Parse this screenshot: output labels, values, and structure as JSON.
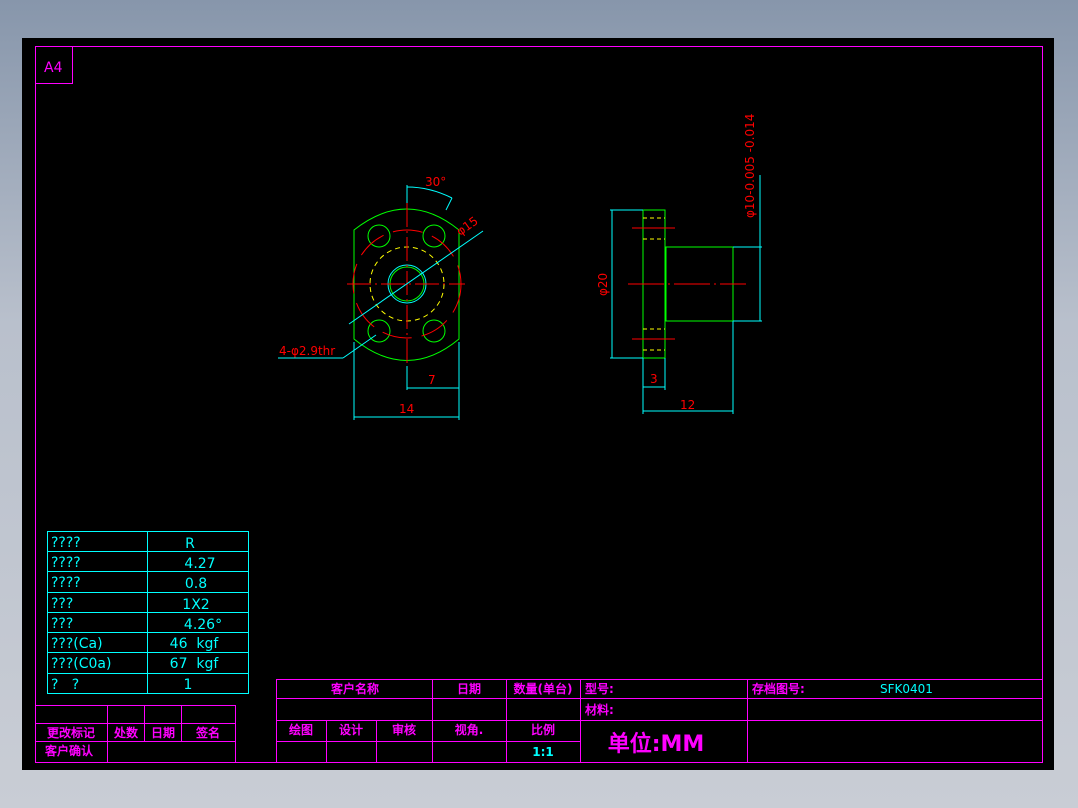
{
  "sheet": {
    "size_label": "A4"
  },
  "drawing": {
    "dims": {
      "angle": "30°",
      "pcd": "φ15",
      "holes": "4-φ2.9thr",
      "half_width": "7",
      "width": "14",
      "flange_dia": "φ20",
      "shaft_dia": "φ10-0.005 -0.014",
      "flange_thk": "3",
      "length": "12"
    }
  },
  "params_table": {
    "rows": [
      {
        "label": "????",
        "value": "R"
      },
      {
        "label": "????",
        "value": "4.27"
      },
      {
        "label": "????",
        "value": "0.8"
      },
      {
        "label": "???",
        "value": "1X2"
      },
      {
        "label": "???",
        "value": "4.26°"
      },
      {
        "label": "???(Ca)",
        "value": "46  kgf"
      },
      {
        "label": "???(C0a)",
        "value": "67  kgf"
      },
      {
        "label": "?   ?",
        "value": "1"
      }
    ]
  },
  "revision_table": {
    "change_mark": "更改标记",
    "count": "处数",
    "date": "日期",
    "signature": "签名",
    "customer_confirm": "客户确认"
  },
  "title_block": {
    "customer_name": "客户名称",
    "date": "日期",
    "quantity": "数量(单台)",
    "model": "型号:",
    "archive_no_label": "存档图号:",
    "archive_no": "SFK0401",
    "material": "材料:",
    "drawn": "绘图",
    "design": "设计",
    "review": "审核",
    "view_angle": "视角.",
    "scale_label": "比例",
    "scale": "1:1",
    "unit": "单位:MM"
  },
  "colors": {
    "frame": "#ff00ff",
    "dim": "#00ffff",
    "center": "#ff0000",
    "outline": "#00ff00",
    "hidden": "#ffff00"
  }
}
